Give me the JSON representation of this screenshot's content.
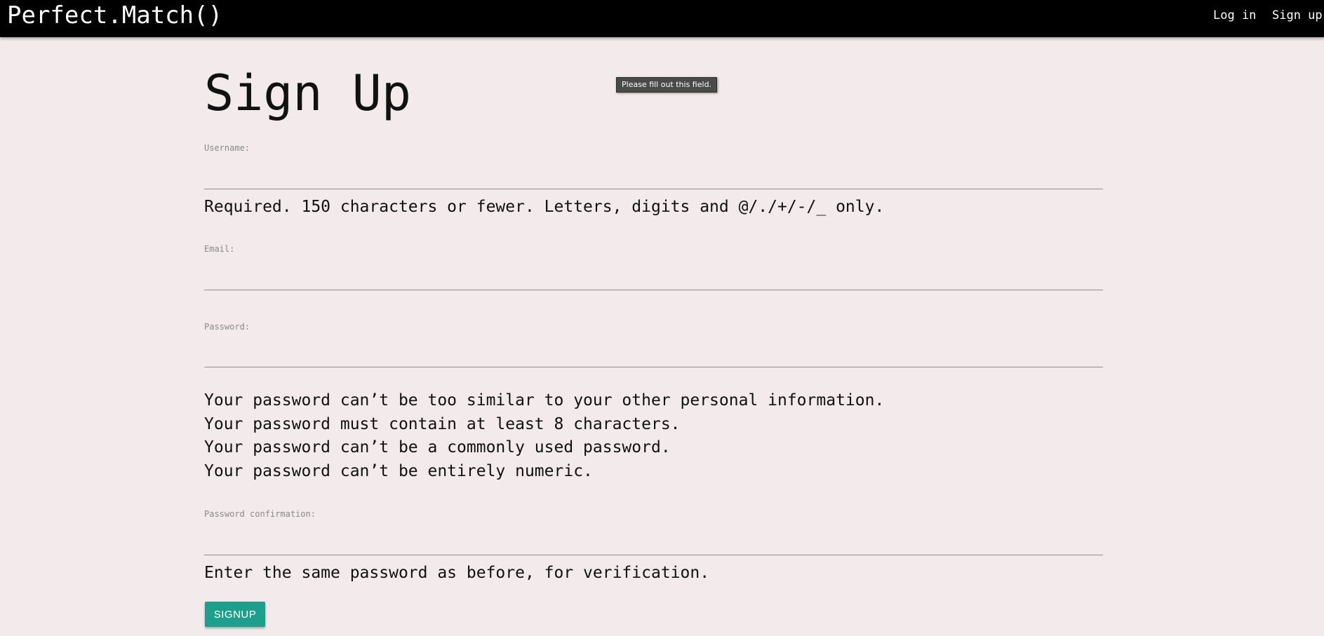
{
  "navbar": {
    "brand": "Perfect.Match()",
    "links": [
      {
        "label": "Log in"
      },
      {
        "label": "Sign up"
      }
    ]
  },
  "page": {
    "title": "Sign Up"
  },
  "tooltip": {
    "text": "Please fill out this field."
  },
  "form": {
    "username": {
      "label": "Username:",
      "value": "",
      "help": "Required. 150 characters or fewer. Letters, digits and @/./+/-/_ only."
    },
    "email": {
      "label": "Email:",
      "value": ""
    },
    "password": {
      "label": "Password:",
      "value": "",
      "rules": [
        "Your password can’t be too similar to your other personal information.",
        "Your password must contain at least 8 characters.",
        "Your password can’t be a commonly used password.",
        "Your password can’t be entirely numeric."
      ]
    },
    "password_confirmation": {
      "label": "Password confirmation:",
      "value": "",
      "help": "Enter the same password as before, for verification."
    },
    "submit_label": "SIGNUP"
  },
  "colors": {
    "navbar_bg": "#000000",
    "page_bg": "#f2eaeb",
    "button_bg": "#1e9e8c",
    "tooltip_bg": "#4a4a4a"
  }
}
